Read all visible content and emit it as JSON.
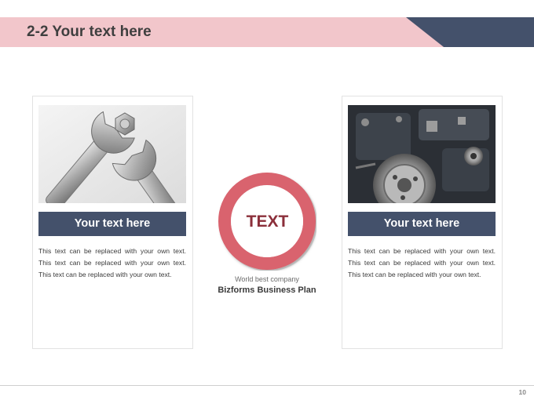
{
  "slide": {
    "title": "2-2 Your text here",
    "page_number": "10"
  },
  "left_card": {
    "banner": "Your text here",
    "body": "This text can be replaced with your own text. This text can be replaced with your own text. This text can be replaced with your own text."
  },
  "right_card": {
    "banner": "Your text here",
    "body": "This text can be replaced with your own text. This text can be replaced with your own text. This text can be replaced with your own text."
  },
  "center": {
    "ring_label": "TEXT",
    "company_tagline": "World best company",
    "company_name": "Bizforms Business Plan"
  },
  "colors": {
    "header_pink": "#f2c6cb",
    "navy": "#44516b",
    "ring_red": "#d9636e"
  }
}
